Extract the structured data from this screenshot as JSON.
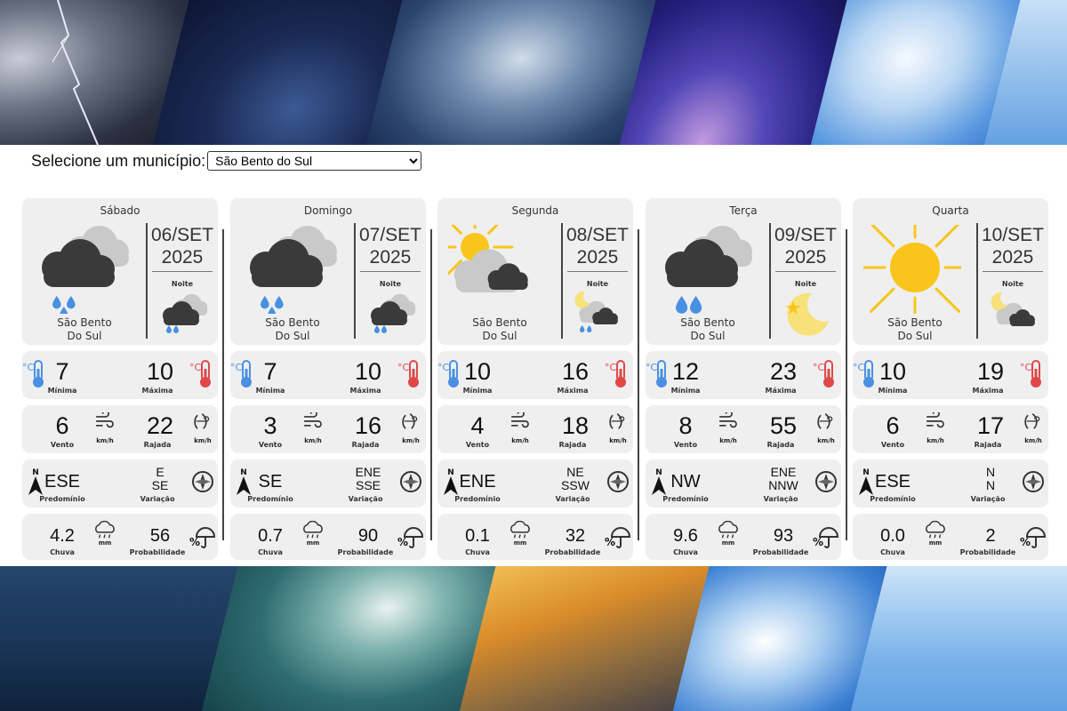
{
  "selector": {
    "label": "Selecione um município:",
    "selected": "São Bento do Sul"
  },
  "labels": {
    "noite": "Noite",
    "minima": "Mínima",
    "maxima": "Máxima",
    "vento": "Vento",
    "rajada": "Rajada",
    "predominio": "Predomínio",
    "variacao": "Variação",
    "chuva": "Chuva",
    "probabilidade": "Probabilidade",
    "kmh": "km/h",
    "mm": "mm",
    "north": "N"
  },
  "colors": {
    "cold": "#4a90e2",
    "hot": "#e04848",
    "sun": "#f9c51c",
    "cloud_dark": "#3a3a3a",
    "cloud_light": "#c9c9c9",
    "rain": "#4a90e2"
  },
  "days": [
    {
      "name": "Sábado",
      "date": "06/SET",
      "year": "2025",
      "city1": "São Bento",
      "city2": "Do Sul",
      "day_icon": "rain-cloud-icon",
      "night_icon": "rain-cloud-icon",
      "min": "7",
      "max": "10",
      "wind": "6",
      "gust": "22",
      "dir_main": "ESE",
      "dir_var1": "E",
      "dir_var2": "SE",
      "rain": "4.2",
      "prob": "56"
    },
    {
      "name": "Domingo",
      "date": "07/SET",
      "year": "2025",
      "city1": "São Bento",
      "city2": "Do Sul",
      "day_icon": "rain-cloud-icon",
      "night_icon": "rain-cloud-icon",
      "min": "7",
      "max": "10",
      "wind": "3",
      "gust": "16",
      "dir_main": "SE",
      "dir_var1": "ENE",
      "dir_var2": "SSE",
      "rain": "0.7",
      "prob": "90"
    },
    {
      "name": "Segunda",
      "date": "08/SET",
      "year": "2025",
      "city1": "São Bento",
      "city2": "Do Sul",
      "day_icon": "partly-cloudy-icon",
      "night_icon": "moon-rain-cloud-icon",
      "min": "10",
      "max": "16",
      "wind": "4",
      "gust": "18",
      "dir_main": "ENE",
      "dir_var1": "NE",
      "dir_var2": "SSW",
      "rain": "0.1",
      "prob": "32"
    },
    {
      "name": "Terça",
      "date": "09/SET",
      "year": "2025",
      "city1": "São Bento",
      "city2": "Do Sul",
      "day_icon": "heavy-rain-cloud-icon",
      "night_icon": "moon-star-icon",
      "min": "12",
      "max": "23",
      "wind": "8",
      "gust": "55",
      "dir_main": "NW",
      "dir_var1": "ENE",
      "dir_var2": "NNW",
      "rain": "9.6",
      "prob": "93"
    },
    {
      "name": "Quarta",
      "date": "10/SET",
      "year": "2025",
      "city1": "São Bento",
      "city2": "Do Sul",
      "day_icon": "sun-icon",
      "night_icon": "moon-cloud-icon",
      "min": "10",
      "max": "19",
      "wind": "6",
      "gust": "17",
      "dir_main": "ESE",
      "dir_var1": "N",
      "dir_var2": "N",
      "rain": "0.0",
      "prob": "2"
    }
  ]
}
